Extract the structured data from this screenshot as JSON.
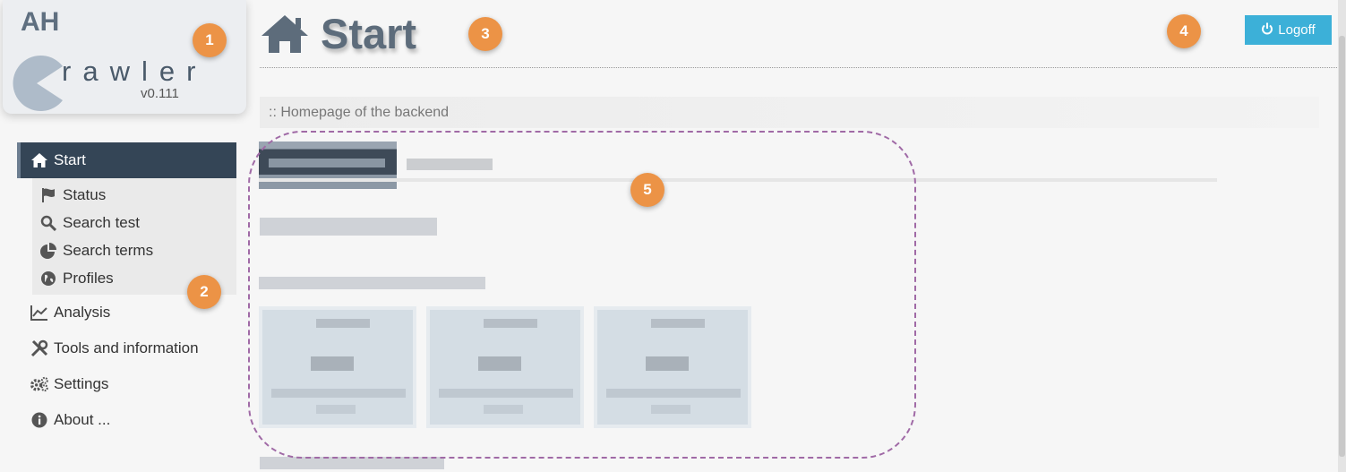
{
  "logo": {
    "prefix": "AH",
    "word": "rawler",
    "version": "v0.111"
  },
  "header": {
    "title": "Start",
    "logoff_label": "Logoff"
  },
  "subtitle": ":: Homepage of the backend",
  "sidebar": {
    "items": [
      {
        "label": "Start",
        "icon": "home-icon",
        "active": true
      },
      {
        "label": "Status",
        "icon": "flag-icon"
      },
      {
        "label": "Search test",
        "icon": "search-icon"
      },
      {
        "label": "Search terms",
        "icon": "pie-chart-icon"
      },
      {
        "label": "Profiles",
        "icon": "globe-icon"
      },
      {
        "label": "Analysis",
        "icon": "line-chart-icon"
      },
      {
        "label": "Tools and information",
        "icon": "tools-icon"
      },
      {
        "label": "Settings",
        "icon": "gears-icon"
      },
      {
        "label": "About ...",
        "icon": "info-icon"
      }
    ]
  },
  "callouts": [
    "1",
    "2",
    "3",
    "4",
    "5"
  ],
  "colors": {
    "accent": "#3cb0d8",
    "nav_active": "#344556",
    "callout": "#ec9346",
    "highlight": "#a06aa6"
  }
}
